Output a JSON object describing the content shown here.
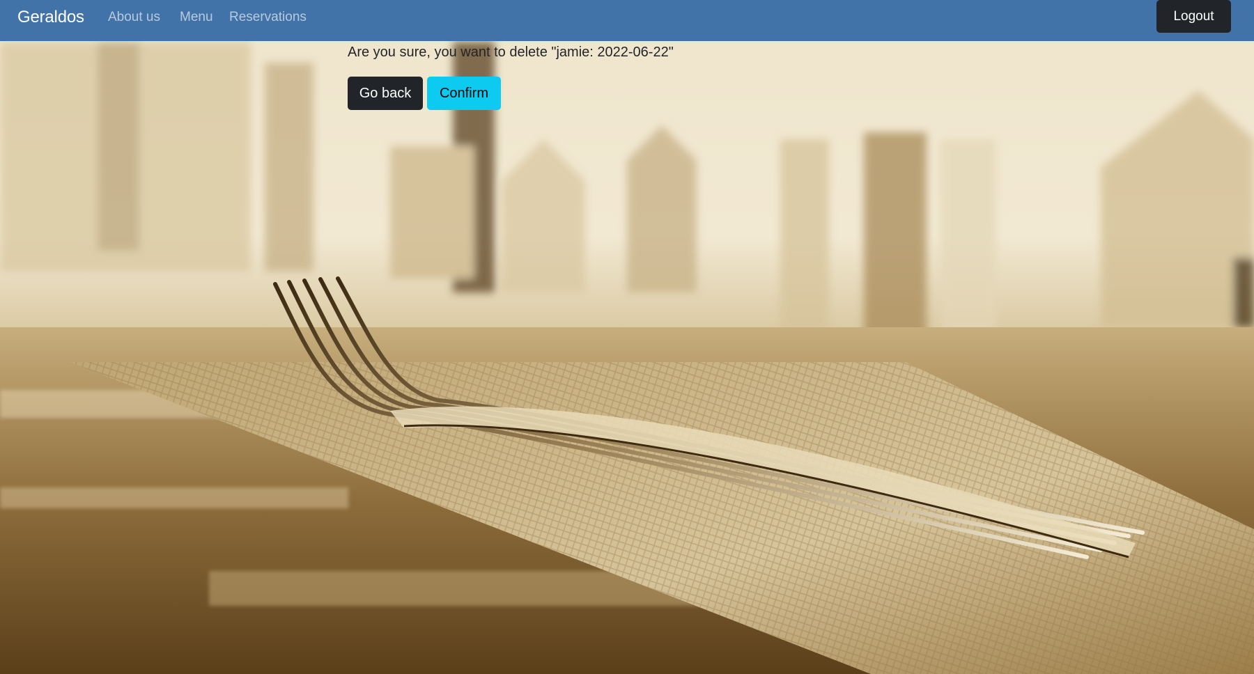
{
  "navbar": {
    "brand": "Geraldos",
    "links": [
      {
        "label": "About us"
      },
      {
        "label": "Menu"
      },
      {
        "label": "Reservations"
      }
    ],
    "logout_label": "Logout"
  },
  "dialog": {
    "question": "Are you sure, you want to delete \"jamie: 2022-06-22\"",
    "go_back_label": "Go back",
    "confirm_label": "Confirm"
  },
  "colors": {
    "navbar": "#4173a8",
    "dark_button": "#212529",
    "confirm_button": "#0dcaf0",
    "background_tint": "sepia"
  },
  "background_image": "restaurant-table-fork-photo"
}
